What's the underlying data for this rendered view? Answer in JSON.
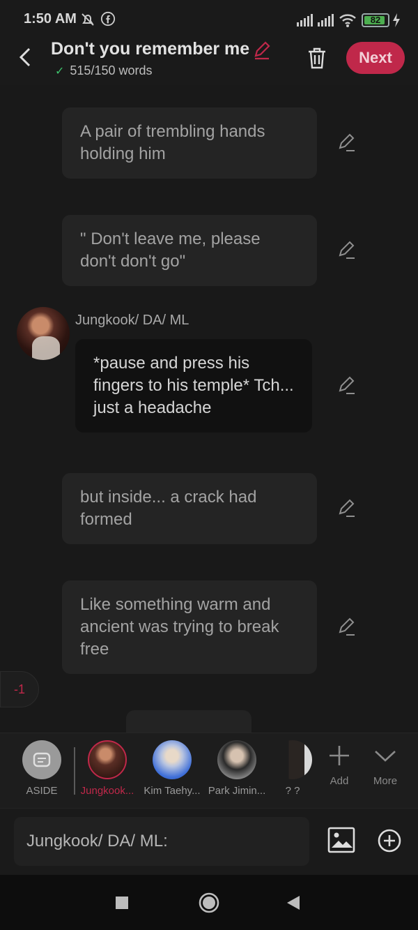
{
  "status": {
    "time": "1:50 AM",
    "battery": "82"
  },
  "header": {
    "title": "Don't you remember me",
    "word_count": "515/150 words",
    "next_label": "Next"
  },
  "messages": [
    {
      "type": "narration",
      "text": "A pair of trembling hands holding him"
    },
    {
      "type": "narration",
      "text": "\" Don't leave me, please don't don't go\""
    },
    {
      "type": "character",
      "speaker": "Jungkook/ DA/ ML",
      "text": "*pause and press his fingers to his temple* Tch... just a headache"
    },
    {
      "type": "narration",
      "text": "but inside... a crack had formed"
    },
    {
      "type": "narration",
      "text": "Like something warm and ancient was trying to break free"
    }
  ],
  "scroll_chip": "-1",
  "characters": [
    {
      "label": "ASIDE"
    },
    {
      "label": "Jungkook...",
      "active": true
    },
    {
      "label": "Kim Taehy..."
    },
    {
      "label": "Park Jimin..."
    },
    {
      "label": "? ?"
    }
  ],
  "tools": {
    "add_label": "Add",
    "more_label": "More"
  },
  "input": {
    "value": "Jungkook/ DA/ ML:"
  },
  "colors": {
    "accent": "#c0284a",
    "background": "#1a1a1a",
    "bubble": "#242424"
  }
}
